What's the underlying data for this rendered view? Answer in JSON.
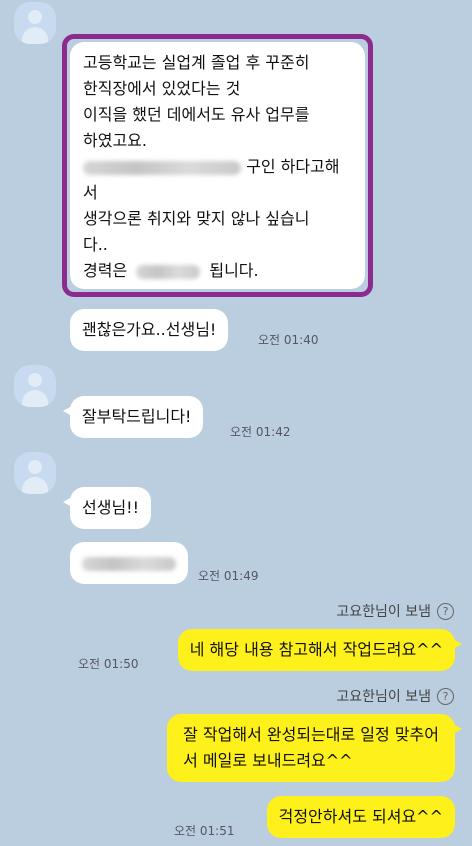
{
  "messages": {
    "first": {
      "lines": [
        "고등학교는 실업계 졸업 후 꾸준히",
        "한직장에서 있었다는 것",
        "이직을 했던 데에서도 유사 업무를",
        "하였고요.",
        "구인 하다고해",
        "서",
        "생각으론 취지와 맞지 않나 싶습니",
        "다..",
        "경력은",
        "됩니다."
      ]
    },
    "okay": {
      "text": "괜찮은가요..선생님!",
      "time": "오전 01:40"
    },
    "please": {
      "text": "잘부탁드립니다!",
      "time": "오전 01:42"
    },
    "teacher": {
      "text": "선생님!!"
    },
    "blurred": {
      "time": "오전 01:49"
    },
    "reply1": {
      "status": "고요한님이 보냄",
      "text": "네 해당 내용 참고해서 작업드려요^^",
      "time": "오전 01:50"
    },
    "reply2": {
      "status": "고요한님이 보냄",
      "line1": "잘 작업해서 완성되는대로 일정 맞추어",
      "line2": "서 메일로 보내드려요^^"
    },
    "reply3": {
      "text": "걱정안하셔도 되셔요^^",
      "time": "오전 01:51"
    }
  },
  "icons": {
    "avatar": "default-profile-icon",
    "help": "question-circle-icon",
    "help_glyph": "?"
  },
  "colors": {
    "background": "#bacee0",
    "incoming": "#ffffff",
    "outgoing": "#fef01b",
    "highlight": "#8b2b8e"
  }
}
